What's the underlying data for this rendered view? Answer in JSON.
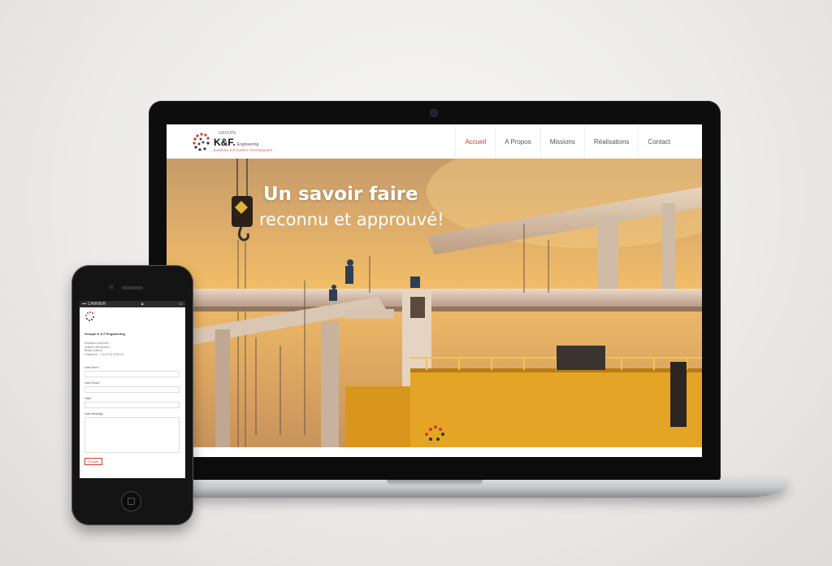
{
  "site": {
    "logo": {
      "groupe": "GROUPE",
      "name": "K&F.",
      "suffix": "Engineering",
      "tagline": "BUREAU D'ÉTUDES TECHNIQUES"
    },
    "nav": [
      {
        "label": "Accueil",
        "active": true
      },
      {
        "label": "A Propos",
        "active": false
      },
      {
        "label": "Missions",
        "active": false
      },
      {
        "label": "Réalisations",
        "active": false
      },
      {
        "label": "Contact",
        "active": false
      }
    ],
    "hero": {
      "title": "Un savoir faire",
      "subtitle": "reconnu et approuvé!"
    }
  },
  "mobile": {
    "status": {
      "carrier": "CARRIER"
    },
    "company": "Groupe K & F Engineering",
    "address": [
      "Résidence Bracine I",
      "Quartier Sidi Brahim",
      "Bedjio (Alaïcc)",
      "Téléphone : +213 5 35 25 80 44"
    ],
    "form": {
      "name_label": "Votre Nom *",
      "email_label": "Votre Email *",
      "subject_label": "Objet",
      "message_label": "Votre Message",
      "submit_label": "Envoyer"
    }
  },
  "colors": {
    "accent": "#d43b24",
    "hero_gold": "#f0b85f",
    "device_dark": "#0d0d0d"
  }
}
